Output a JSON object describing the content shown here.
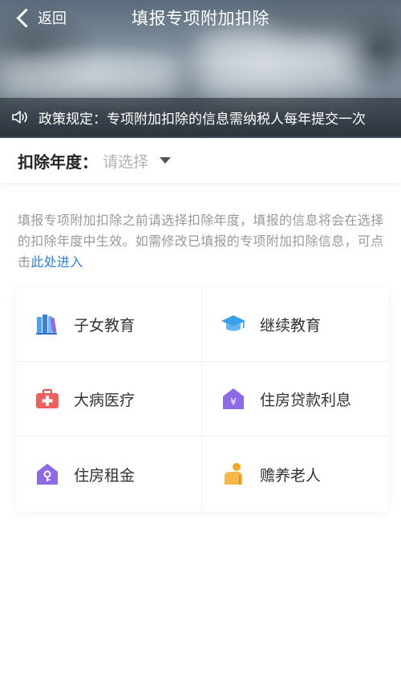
{
  "nav": {
    "back_label": "返回",
    "title": "填报专项附加扣除"
  },
  "notice": {
    "icon": "speaker-icon",
    "text": "政策规定：专项附加扣除的信息需纳税人每年提交一次"
  },
  "deduction_year": {
    "label": "扣除年度：",
    "placeholder": "请选择"
  },
  "description": {
    "text": "填报专项附加扣除之前请选择扣除年度，填报的信息将会在选择的扣除年度中生效。如需修改已填报的专项附加扣除信息，可点击",
    "link": "此处进入"
  },
  "categories": [
    {
      "label": "子女教育",
      "icon": "books-icon",
      "color": "#4a90e2"
    },
    {
      "label": "继续教育",
      "icon": "graduation-cap-icon",
      "color": "#3aa0e8"
    },
    {
      "label": "大病医疗",
      "icon": "medical-kit-icon",
      "color": "#f0605a"
    },
    {
      "label": "住房贷款利息",
      "icon": "house-yuan-icon",
      "color": "#8f6ae6"
    },
    {
      "label": "住房租金",
      "icon": "house-key-icon",
      "color": "#8f6ae6"
    },
    {
      "label": "赡养老人",
      "icon": "elderly-person-icon",
      "color": "#f5a623"
    }
  ],
  "colors": {
    "link": "#2b7fd8",
    "text_muted": "#999999",
    "placeholder": "#b3b3b3"
  }
}
